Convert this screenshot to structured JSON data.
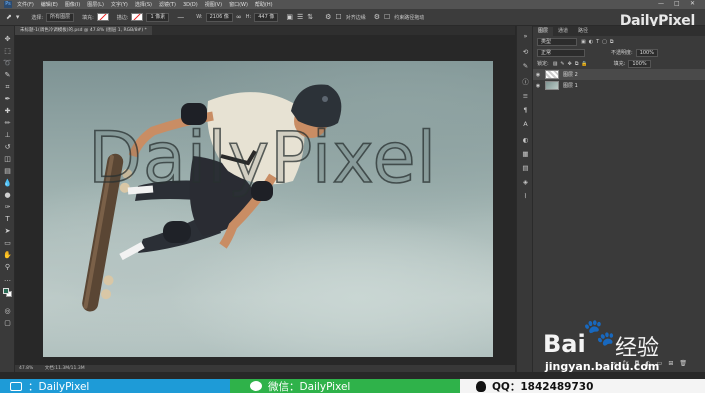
{
  "menubar": {
    "items": [
      "文件(F)",
      "编辑(E)",
      "图像(I)",
      "图层(L)",
      "文字(Y)",
      "选择(S)",
      "滤镜(T)",
      "3D(D)",
      "视图(V)",
      "窗口(W)",
      "帮助(H)"
    ],
    "window_buttons": [
      "—",
      "□",
      "✕"
    ]
  },
  "optbar": {
    "select_label": "选择:",
    "select_value": "所有图层",
    "fill_label": "填充:",
    "stroke_label": "描边:",
    "stroke_width": "1 像素",
    "w_label": "W:",
    "w_value": "2106 像",
    "h_label": "H:",
    "h_value": "447 像",
    "align_edges": "对齐边缘",
    "constrain": "约束路径拖动"
  },
  "watermark_top": "DailyPixel",
  "doctab": {
    "title": "未标题-1(调色冷调模板)的.psd @ 47.8% (图层 1, RGB/8#) *"
  },
  "canvas": {
    "photo_text": "DailyPixel"
  },
  "status": {
    "zoom": "47.8%",
    "doc": "文档:11.3M/11.3M"
  },
  "panel": {
    "tabs": [
      "图层",
      "通道",
      "路径"
    ],
    "kind_label": "类型",
    "blend_mode": "正常",
    "opacity_label": "不透明度:",
    "opacity_value": "100%",
    "lock_label": "锁定:",
    "fill_label": "填充:",
    "fill_value": "100%",
    "layers": [
      {
        "name": "图层 2",
        "selected": true
      },
      {
        "name": "图层 1",
        "selected": false
      }
    ]
  },
  "baidu": {
    "logo_left": "Bai",
    "logo_right": "经验",
    "url": "jingyan.baidu.com"
  },
  "banner": {
    "bilibili": "：DailyPixel",
    "wechat": "微信：DailyPixel",
    "qq": "QQ：1842489730"
  }
}
